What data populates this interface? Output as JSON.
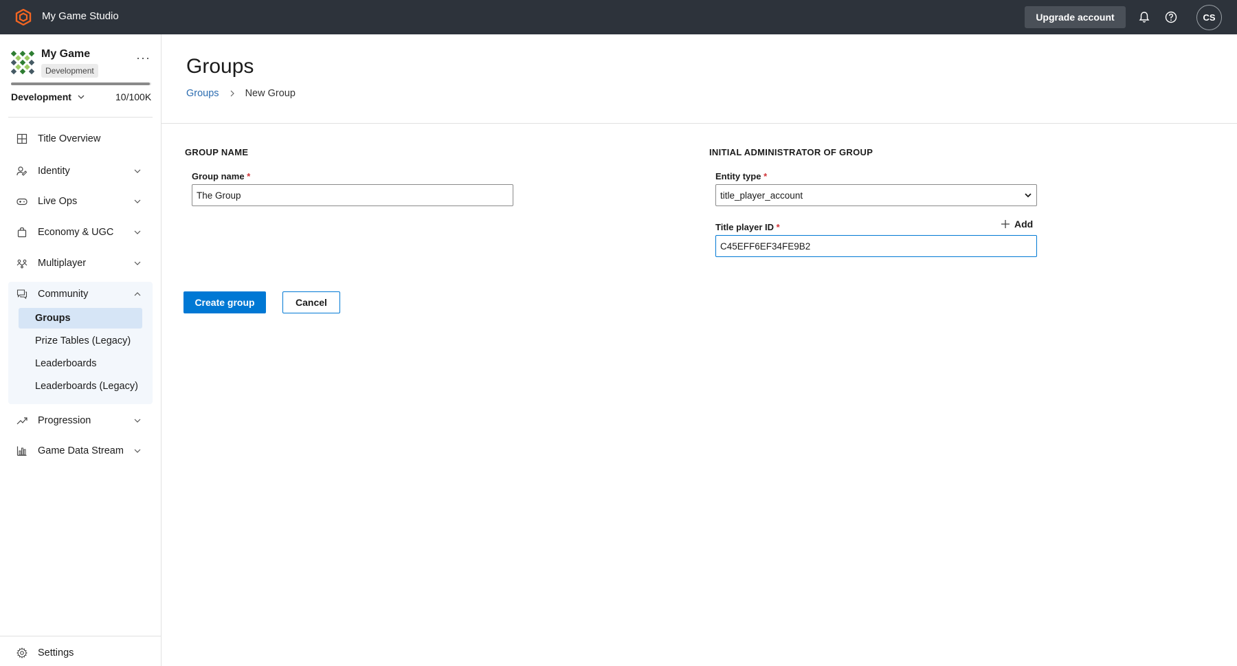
{
  "app": {
    "studio_name": "My Game Studio",
    "upgrade_label": "Upgrade account",
    "user_initials": "CS"
  },
  "sidebar": {
    "game_name": "My Game",
    "environment_badge": "Development",
    "environment_select": "Development",
    "quota_text": "10/100K",
    "quota_fraction": 0.99,
    "nav": [
      {
        "label": "Title Overview",
        "icon": "grid-icon"
      },
      {
        "label": "Identity",
        "icon": "identity-icon"
      },
      {
        "label": "Live Ops",
        "icon": "gamepad-icon"
      },
      {
        "label": "Economy & UGC",
        "icon": "shopping-bag-icon"
      },
      {
        "label": "Multiplayer",
        "icon": "multiplayer-icon"
      },
      {
        "label": "Community",
        "icon": "chat-icon"
      },
      {
        "label": "Progression",
        "icon": "trend-up-icon"
      },
      {
        "label": "Game Data Stream",
        "icon": "bar-chart-icon"
      }
    ],
    "community_items": [
      {
        "label": "Groups",
        "active": true
      },
      {
        "label": "Prize Tables (Legacy)"
      },
      {
        "label": "Leaderboards"
      },
      {
        "label": "Leaderboards (Legacy)"
      }
    ],
    "settings_label": "Settings"
  },
  "main": {
    "title": "Groups",
    "breadcrumb": {
      "parent": "Groups",
      "current": "New Group"
    },
    "group_section": {
      "title": "GROUP NAME",
      "label": "Group name",
      "required_mark": "*",
      "value": "The Group"
    },
    "admin_section": {
      "title": "INITIAL ADMINISTRATOR OF GROUP",
      "entity_type_label": "Entity type",
      "entity_type_value": "title_player_account",
      "player_id_label": "Title player ID",
      "player_id_value": "C45EFF6EF34FE9B2",
      "add_label": "Add",
      "required_mark": "*"
    },
    "create_label": "Create group",
    "cancel_label": "Cancel"
  },
  "colors": {
    "topbar": "#2d333b",
    "primary": "#0078d4",
    "link": "#2b6cb0",
    "required": "#d13438",
    "logo_orange": "#f26522"
  }
}
